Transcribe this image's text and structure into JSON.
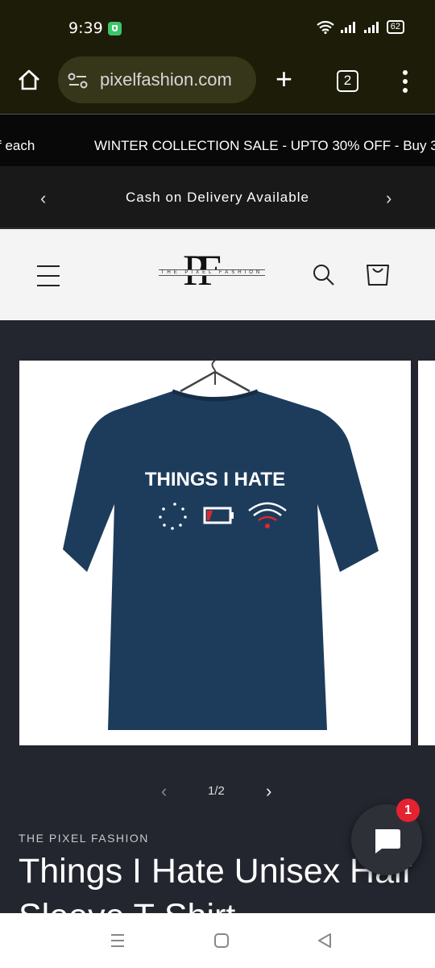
{
  "status_bar": {
    "time": "9:39",
    "battery": "62",
    "icons": [
      "security-shield-icon",
      "wifi-icon",
      "cellular-signal-icon",
      "cellular-signal-icon",
      "battery-icon"
    ]
  },
  "browser": {
    "url": "pixelfashion.com",
    "tab_count": "2",
    "icons": [
      "home-icon",
      "site-settings-icon",
      "new-tab-plus-icon",
      "tabs-icon",
      "more-options-icon"
    ]
  },
  "ticker": {
    "left_fragment": "f each",
    "right_text": "WINTER COLLECTION SALE - UPTO 30% OFF - Buy 3"
  },
  "announcement": {
    "text": "Cash on Delivery Available",
    "prev_symbol": "‹",
    "next_symbol": "›"
  },
  "header": {
    "logo_letters": "PF",
    "logo_tagline": "THE PIXEL FASHION",
    "icons": [
      "menu-icon",
      "search-icon",
      "cart-icon"
    ]
  },
  "product_image": {
    "shirt_print": "THINGS I HATE",
    "shirt_color": "#1d3c5c",
    "print_icons": [
      "loading-spinner-icon",
      "low-battery-icon",
      "weak-wifi-icon"
    ],
    "accent_red": "#e0282c"
  },
  "gallery_pager": {
    "prev_symbol": "‹",
    "current": "1/2",
    "next_symbol": "›"
  },
  "product": {
    "vendor": "THE PIXEL FASHION",
    "title_line1": "Things I Hate Unisex Half",
    "title_line2": "Sleeve T-Shirt"
  },
  "chat": {
    "badge_count": "1"
  },
  "nav_bar": {
    "icons": [
      "recent-apps-icon",
      "home-square-icon",
      "back-triangle-icon"
    ]
  }
}
